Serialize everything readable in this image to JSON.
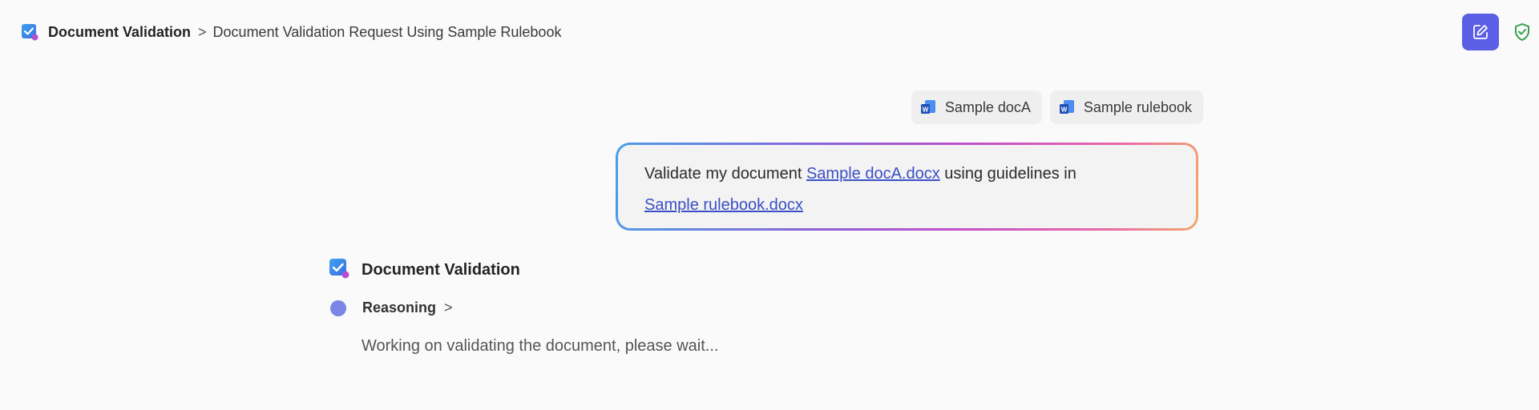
{
  "breadcrumb": {
    "root": "Document Validation",
    "separator": ">",
    "current": "Document Validation Request Using Sample Rulebook"
  },
  "header": {
    "compose_icon": "new-chat-icon",
    "shield_icon": "shield-check-icon",
    "accent_color": "#5b5fe6",
    "shield_color": "#3aa04a"
  },
  "attachments": [
    {
      "label": "Sample docA",
      "icon": "word-file-icon"
    },
    {
      "label": "Sample rulebook",
      "icon": "word-file-icon"
    }
  ],
  "prompt": {
    "text_before": "Validate my document ",
    "link1": "Sample docA.docx",
    "text_middle": " using guidelines in",
    "link2": "Sample rulebook.docx"
  },
  "response": {
    "agent_name": "Document Validation",
    "reasoning_label": "Reasoning",
    "reasoning_chevron": ">",
    "status": "Working on validating the document, please wait..."
  }
}
